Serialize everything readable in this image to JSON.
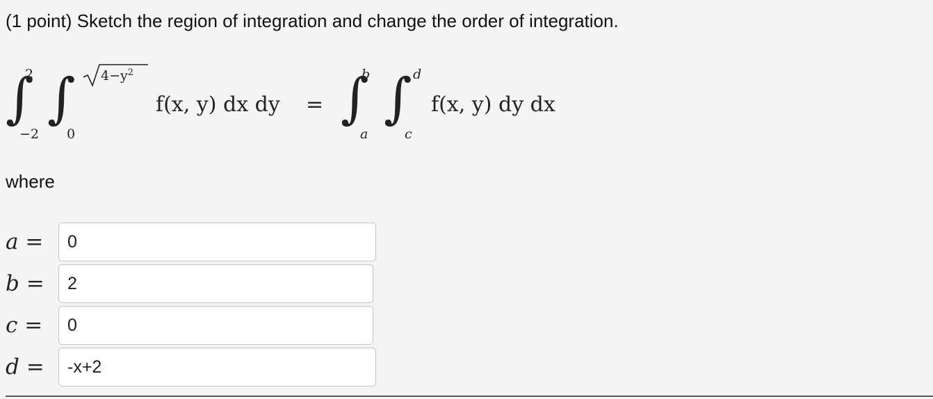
{
  "problem": {
    "text": "(1 point) Sketch the region of integration and change the order of integration."
  },
  "integral_left": {
    "outer_lower": "−2",
    "outer_upper": "2",
    "inner_lower": "0",
    "inner_upper_radicand": "4−y",
    "inner_upper_exponent": "2",
    "integrand": "f(x, y) dx dy"
  },
  "equals_sign": "=",
  "integral_right": {
    "outer_lower": "a",
    "outer_upper": "b",
    "inner_lower": "c",
    "inner_upper": "d",
    "integrand": "f(x, y) dy dx"
  },
  "where_label": "where",
  "answers": [
    {
      "var": "a",
      "value": "0"
    },
    {
      "var": "b",
      "value": "2"
    },
    {
      "var": "c",
      "value": "0"
    },
    {
      "var": "d",
      "value": "-x+2"
    }
  ]
}
